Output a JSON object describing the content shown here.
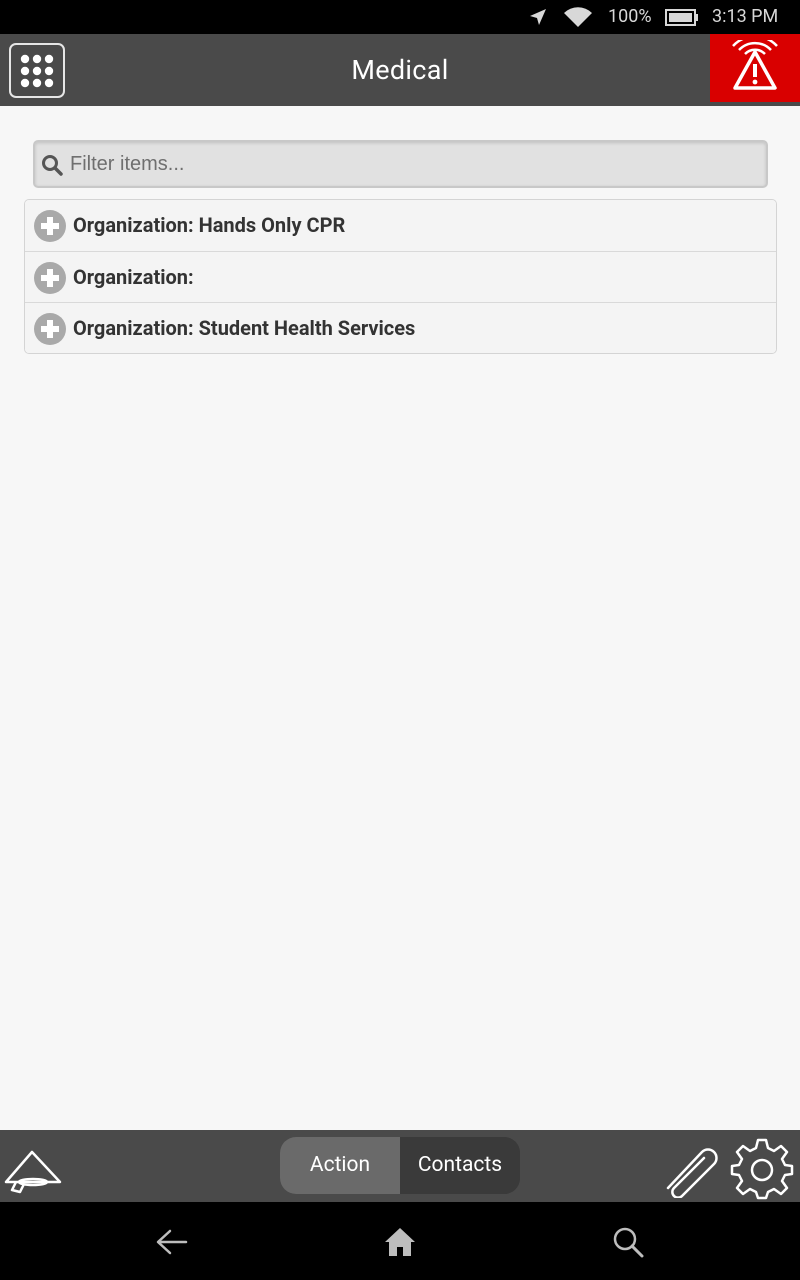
{
  "status_bar": {
    "battery_percent": "100%",
    "time": "3:13 PM",
    "icons": [
      "location-arrow-icon",
      "wifi-icon",
      "battery-icon"
    ]
  },
  "header": {
    "title": "Medical",
    "apps_icon": "apps-grid-icon",
    "alert_icon": "alert-triangle-icon",
    "alert_color": "#d90000"
  },
  "filter": {
    "placeholder": "Filter items...",
    "value": ""
  },
  "list": {
    "items": [
      {
        "label": "Organization: Hands Only CPR"
      },
      {
        "label": "Organization:"
      },
      {
        "label": "Organization: Student Health Services"
      }
    ]
  },
  "bottom_bar": {
    "segments": [
      {
        "label": "Action",
        "selected": true
      },
      {
        "label": "Contacts",
        "selected": false
      }
    ],
    "icons": [
      "megaphone-icon",
      "paperclip-icon",
      "gear-icon"
    ]
  },
  "nav_bar": {
    "icons": [
      "back-arrow-icon",
      "home-icon",
      "search-icon"
    ]
  },
  "colors": {
    "header_bg": "#4a4a4a",
    "background": "#f7f7f7",
    "alert": "#d90000"
  }
}
